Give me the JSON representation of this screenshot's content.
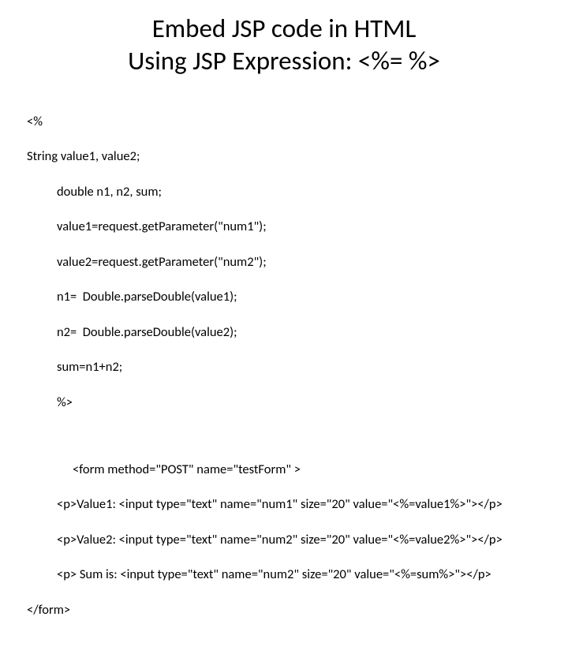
{
  "title": {
    "line1": "Embed JSP code in HTML",
    "line2": "Using JSP Expression: <%=      %>"
  },
  "code": {
    "l01": "<%",
    "l02": "String value1, value2;",
    "l03": "double n1, n2, sum;",
    "l04": "value1=request.getParameter(\"num1\");",
    "l05": "value2=request.getParameter(\"num2\");",
    "l06": "n1=  Double.parseDouble(value1);",
    "l07": "n2=  Double.parseDouble(value2);",
    "l08": "sum=n1+n2;",
    "l09": "%>",
    "l10": "<form method=\"POST\" name=\"testForm\" >",
    "l11": "<p>Value1: <input type=\"text\" name=\"num1\" size=\"20\" value=\"<%=value1%>\"></p>",
    "l12": "<p>Value2: <input type=\"text\" name=\"num2\" size=\"20\" value=\"<%=value2%>\"></p>",
    "l13": "<p> Sum is: <input type=\"text\" name=\"num2\" size=\"20\" value=\"<%=sum%>\"></p>",
    "l14": "</form>"
  }
}
